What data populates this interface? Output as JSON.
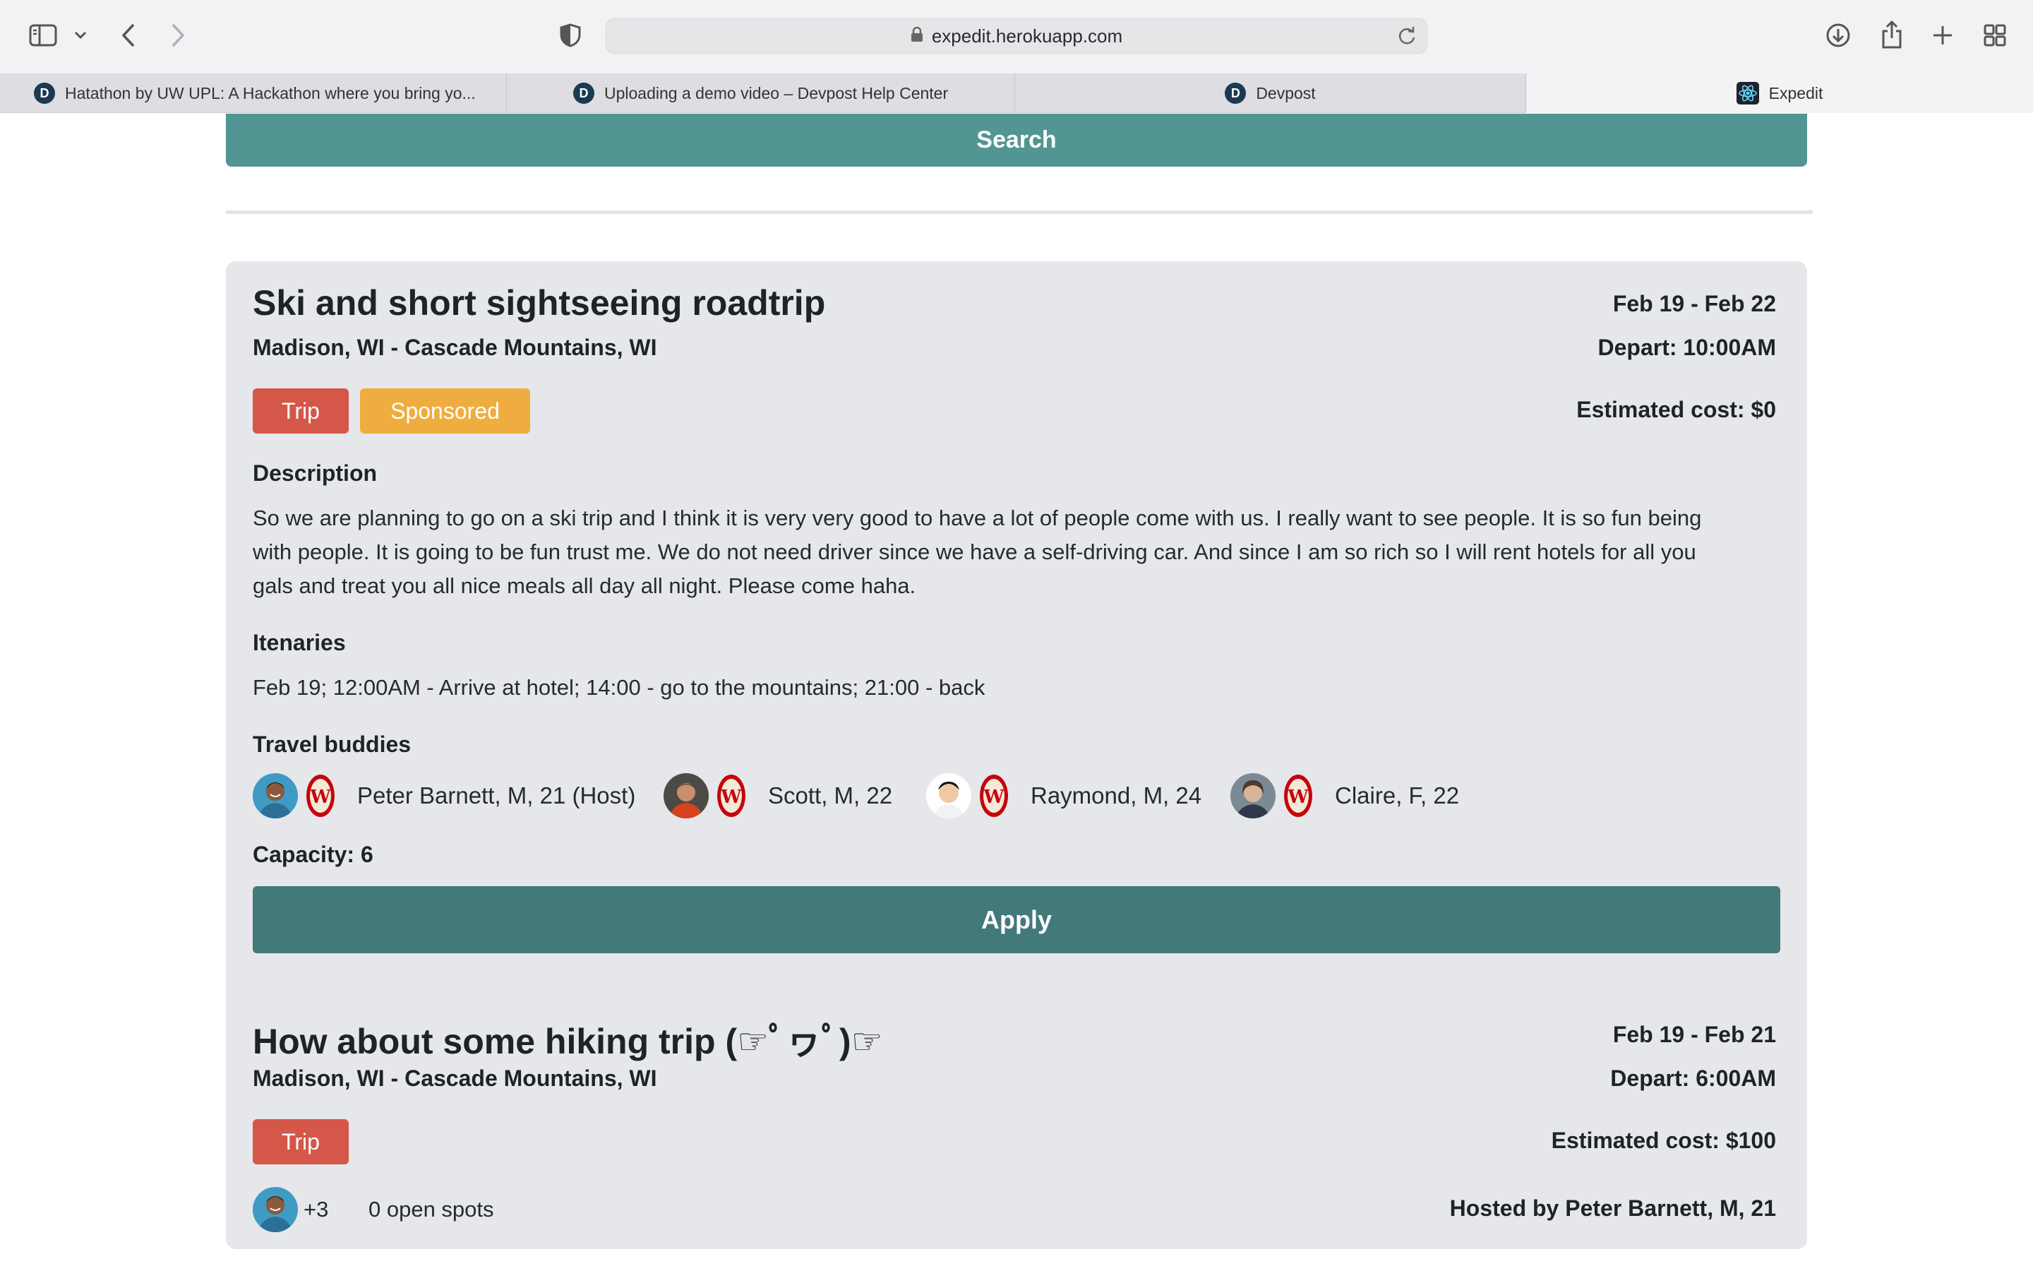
{
  "browser": {
    "url": "expedit.herokuapp.com",
    "tabs": [
      {
        "label": "Hatathon by UW UPL: A Hackathon where you bring yo...",
        "favicon": "D"
      },
      {
        "label": "Uploading a demo video – Devpost Help Center",
        "favicon": "D"
      },
      {
        "label": "Devpost",
        "favicon": "D"
      },
      {
        "label": "Expedit",
        "favicon": "react-icon"
      }
    ]
  },
  "page": {
    "search_label": "Search"
  },
  "cards": [
    {
      "title": "Ski and short sightseeing roadtrip",
      "route": "Madison, WI - Cascade Mountains, WI",
      "dates": "Feb 19 - Feb 22",
      "depart": "Depart: 10:00AM",
      "cost": "Estimated cost: $0",
      "tags": [
        "Trip",
        "Sponsored"
      ],
      "description_heading": "Description",
      "description_lines": [
        "So we are planning to go on a ski trip and I think it is very very good to have a lot of people come with us. I really want to see people. It is so fun being",
        "with people. It is going to be fun trust me. We do not need driver since we have a self-driving car. And since I am so rich so I will rent hotels for all you",
        "gals and treat you all nice meals all day all night. Please come haha."
      ],
      "itinerary_heading": "Itenaries",
      "itinerary": "Feb 19; 12:00AM - Arrive at hotel; 14:00 - go to the mountains; 21:00 - back",
      "buddies_heading": "Travel buddies",
      "buddies": [
        {
          "name": "Peter Barnett, M, 21 (Host)"
        },
        {
          "name": "Scott, M, 22"
        },
        {
          "name": "Raymond, M, 24"
        },
        {
          "name": "Claire, F, 22"
        }
      ],
      "capacity": "Capacity: 6",
      "apply_label": "Apply"
    },
    {
      "title": "How about some hiking trip (☞ﾟヮﾟ)☞",
      "route": "Madison, WI - Cascade Mountains, WI",
      "dates": "Feb 19 - Feb 21",
      "depart": "Depart: 6:00AM",
      "cost": "Estimated cost: $100",
      "tags": [
        "Trip"
      ],
      "extra_count": "+3",
      "open_spots": "0 open spots",
      "host": "Hosted by Peter Barnett, M, 21"
    }
  ],
  "colors": {
    "search": "#519693",
    "apply": "#42797b",
    "trip_tag": "#d4574a",
    "sponsored_tag": "#f0ad3f",
    "card_bg": "#e5e7eb"
  }
}
